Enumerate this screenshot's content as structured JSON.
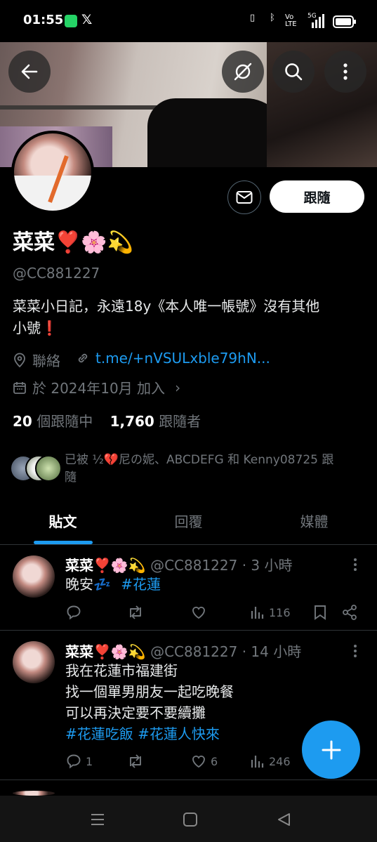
{
  "status_bar": {
    "time": "01:55",
    "network": "5G",
    "volte": "Vo LTE"
  },
  "profile": {
    "follow_label": "跟隨",
    "name": "菜菜❣️🌸💫",
    "handle": "@CC881227",
    "bio_line1": "菜菜小日記，永遠18y《本人唯一帳號》沒有其他",
    "bio_line2": "小號❗",
    "location": "聯絡",
    "link": "t.me/+nVSULxble79hN...",
    "joined": "於 2024年10月 加入",
    "following_count": "20",
    "following_label": "個跟隨中",
    "followers_count": "1,760",
    "followers_label": "跟隨者",
    "followed_by_line1": "已被 ½💔尼の妮、ABCDEFG 和 Kenny08725 跟",
    "followed_by_line2": "隨"
  },
  "tabs": [
    "貼文",
    "回覆",
    "媒體"
  ],
  "posts": [
    {
      "name": "菜菜❣️🌸💫",
      "handle": "@CC881227",
      "time": "· 3 小時",
      "text": "晚安💤",
      "hashtags": "#花蓮",
      "replies": "",
      "reposts": "",
      "likes": "",
      "views": "116"
    },
    {
      "name": "菜菜❣️🌸💫",
      "handle": "@CC881227",
      "time": "· 14 小時",
      "line1": "我在花蓮市福建街",
      "line2": "找一個單男朋友一起吃晚餐",
      "line3": "可以再決定要不要續攤",
      "hashtags": "#花蓮吃飯 #花蓮人快來",
      "replies": "1",
      "reposts": "",
      "likes": "6",
      "views": "246"
    }
  ],
  "colors": {
    "accent": "#1d9bf0",
    "background": "#000000",
    "muted": "#71767b"
  }
}
